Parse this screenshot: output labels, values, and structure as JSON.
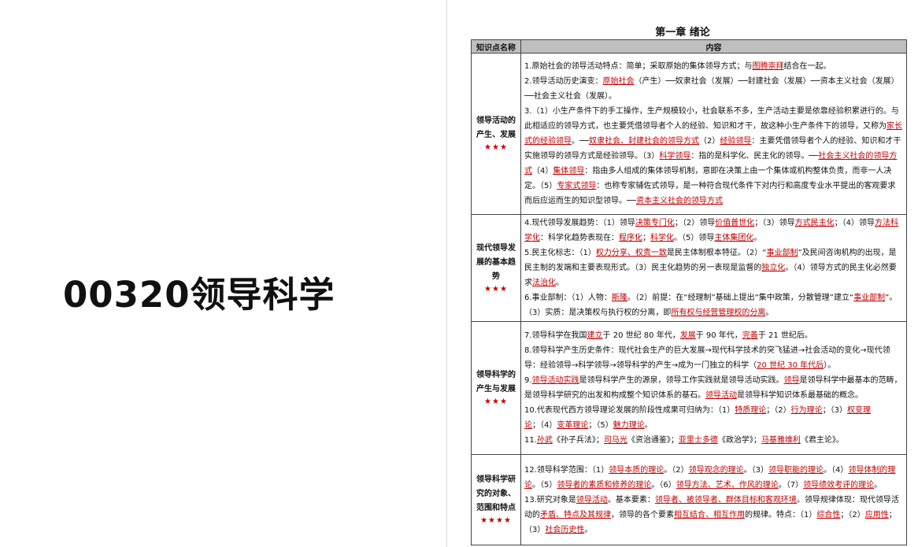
{
  "cover": {
    "title": "00320领导科学"
  },
  "chapter": {
    "title": "第一章 绪论"
  },
  "table": {
    "headers": [
      "知识点名称",
      "内容"
    ],
    "rows": [
      {
        "name": "领导活动的产生、发展",
        "stars": "★★★",
        "items": [
          [
            {
              "t": "1.原始社会的领导活动特点：简单；采取原始的集体领导方式；与"
            },
            {
              "t": "图腾崇拜",
              "u": true
            },
            {
              "t": "结合在一起。"
            }
          ],
          [
            {
              "t": "2.领导活动历史演变："
            },
            {
              "t": "原始社会",
              "u": true
            },
            {
              "t": "（产生）──奴隶社会（发展）──封建社会（发展）──资本主义社会（发展）──社会主义社会（发展）。"
            }
          ],
          [
            {
              "t": "3.（1）小生产条件下的手工操作，生产规模较小，社会联系不多，生产活动主要是依靠经验积累进行的。与此相适应的领导方式，也主要凭借领导者个人的经验、知识和才干，故这种小生产条件下的领导，又称为"
            },
            {
              "t": "家长式的经验领导",
              "u": true
            },
            {
              "t": "。──"
            },
            {
              "t": "奴隶社会、封建社会的领导方式",
              "u": true
            },
            {
              "t": "（2）"
            },
            {
              "t": "经验领导",
              "u": true
            },
            {
              "t": "：主要凭借领导者个人的经验、知识和才干实施领导的领导方式是经验领导。（3）"
            },
            {
              "t": "科学领导",
              "u": true
            },
            {
              "t": "：指的是科学化、民主化的领导。──"
            },
            {
              "t": "社会主义社会的领导方式",
              "u": true
            },
            {
              "t": "（4）"
            },
            {
              "t": "集体领导",
              "u": true
            },
            {
              "t": "：指由多人组成的集体领导机制，意即在决策上由一个集体或机构整体负责，而非一人决定。（5）"
            },
            {
              "t": "专家式领导",
              "u": true
            },
            {
              "t": "：也称专家辅佐式领导，是一种符合现代条件下对内行和高度专业水平提出的客观要求而后应运而生的知识型领导。──"
            },
            {
              "t": "资本主义社会的领导方式",
              "u": true
            }
          ]
        ]
      },
      {
        "name": "现代领导发展的基本趋势",
        "stars": "★★★",
        "items": [
          [
            {
              "t": "4.现代领导发展趋势：（1）领导"
            },
            {
              "t": "决策专门化",
              "u": true
            },
            {
              "t": "；（2）领导"
            },
            {
              "t": "价值普世化",
              "u": true
            },
            {
              "t": "；（3）领导"
            },
            {
              "t": "方式民主化",
              "u": true
            },
            {
              "t": "；（4）领导"
            },
            {
              "t": "方法科学化",
              "u": true
            },
            {
              "t": "：科学化趋势表现在："
            },
            {
              "t": "程序化",
              "u": true
            },
            {
              "t": "；"
            },
            {
              "t": "科学化",
              "u": true
            },
            {
              "t": "。（5）领导"
            },
            {
              "t": "主体集团化",
              "u": true
            },
            {
              "t": "。"
            }
          ],
          [
            {
              "t": "5.民主化标志：（1）"
            },
            {
              "t": "权力分享、权责一致",
              "u": true
            },
            {
              "t": "是民主体制根本特征。（2）“"
            },
            {
              "t": "事业部制",
              "u": true
            },
            {
              "t": "”及民间咨询机构的出现，是民主制的发端和主要表现形式。（3）民主化趋势的另一表现是监督的"
            },
            {
              "t": "独立化",
              "u": true
            },
            {
              "t": "。（4）领导方式的民主化必然要求"
            },
            {
              "t": "法治化",
              "u": true
            },
            {
              "t": "。"
            }
          ],
          [
            {
              "t": "6.事业部制：（1）人物："
            },
            {
              "t": "斯隆",
              "u": true
            },
            {
              "t": "。（2）前提：在“经理制”基础上提出“集中政策，分散管理”建立“"
            },
            {
              "t": "事业部制",
              "u": true
            },
            {
              "t": "”。（3）实质：是决策权与执行权的分离，即"
            },
            {
              "t": "所有权与经营管理权的分离",
              "u": true
            },
            {
              "t": "。"
            }
          ]
        ]
      },
      {
        "name": "领导科学的产生与发展",
        "stars": "★★★",
        "items": [
          [
            {
              "t": "7.领导科学在我国"
            },
            {
              "t": "建立",
              "u": true
            },
            {
              "t": "于 20 世纪 80 年代，"
            },
            {
              "t": "发展",
              "u": true
            },
            {
              "t": "于 90 年代，"
            },
            {
              "t": "完善",
              "u": true
            },
            {
              "t": "于 21 世纪后。"
            }
          ],
          [
            {
              "t": "8.领导科学产生历史条件：现代社会生产的巨大发展→现代科学技术的突飞猛进→社会活动的变化→现代领导：经验领导→科学领导→领导科学的产生→成为一门独立的科学（"
            },
            {
              "t": "20 世纪 30 年代后",
              "u": true
            },
            {
              "t": "）。"
            }
          ],
          [
            {
              "t": "9."
            },
            {
              "t": "领导活动实践",
              "u": true
            },
            {
              "t": "是领导科学产生的源泉，领导工作实践就是领导活动实践。"
            },
            {
              "t": "领导",
              "u": true
            },
            {
              "t": "是领导科学中最基本的范畴，是领导科学研究的出发和构成整个知识体系的基石。"
            },
            {
              "t": "领导活动",
              "u": true
            },
            {
              "t": "是领导科学知识体系最基础的概念。"
            }
          ],
          [
            {
              "t": "10.代表现代西方领导理论发展的阶段性成果可归纳为：（1）"
            },
            {
              "t": "特质理论",
              "u": true
            },
            {
              "t": "；（2）"
            },
            {
              "t": "行为理论",
              "u": true
            },
            {
              "t": "；（3）"
            },
            {
              "t": "权变理论",
              "u": true
            },
            {
              "t": "；（4）"
            },
            {
              "t": "变革理论",
              "u": true
            },
            {
              "t": "；（5）"
            },
            {
              "t": "魅力理论",
              "u": true
            },
            {
              "t": "。"
            }
          ],
          [
            {
              "t": "11."
            },
            {
              "t": "孙武",
              "u": true
            },
            {
              "t": "《孙子兵法》；"
            },
            {
              "t": "司马光",
              "u": true
            },
            {
              "t": "《资治通鉴》；"
            },
            {
              "t": "亚里士多德",
              "u": true
            },
            {
              "t": "《政治学》；"
            },
            {
              "t": "马基雅维利",
              "u": true
            },
            {
              "t": "《君主论》。"
            }
          ]
        ]
      },
      {
        "name": "领导科学研究的对象、范围和特点",
        "stars": "★★★★",
        "items": [
          [
            {
              "t": "12.领导科学范围：（1）"
            },
            {
              "t": "领导本质的理论",
              "u": true
            },
            {
              "t": "。（2）"
            },
            {
              "t": "领导观念的理论",
              "u": true
            },
            {
              "t": "。（3）"
            },
            {
              "t": "领导职能的理论",
              "u": true
            },
            {
              "t": "。（4）"
            },
            {
              "t": "领导体制的理论",
              "u": true
            },
            {
              "t": "。（5）"
            },
            {
              "t": "领导者的素质和修养的理论",
              "u": true
            },
            {
              "t": "。（6）"
            },
            {
              "t": "领导方法、艺术、作风的理论",
              "u": true
            },
            {
              "t": "。（7）"
            },
            {
              "t": "领导绩效考评的理论",
              "u": true
            },
            {
              "t": "。"
            }
          ],
          [
            {
              "t": "13.研究对象是"
            },
            {
              "t": "领导活动",
              "u": true
            },
            {
              "t": "。基本要素："
            },
            {
              "t": "领导者、被领导者、群体目标和客观环境",
              "u": true
            },
            {
              "t": "。领导规律体现：现代领导活动的"
            },
            {
              "t": "矛盾、特点及其规律",
              "u": true
            },
            {
              "t": "，领导的各个要素"
            },
            {
              "t": "相互结合、相互作用",
              "u": true
            },
            {
              "t": "的规律。特点：（1）"
            },
            {
              "t": "综合性",
              "u": true
            },
            {
              "t": "；（2）"
            },
            {
              "t": "应用性",
              "u": true
            },
            {
              "t": "；（3）"
            },
            {
              "t": "社会历史性",
              "u": true
            },
            {
              "t": "。"
            }
          ]
        ]
      }
    ]
  }
}
